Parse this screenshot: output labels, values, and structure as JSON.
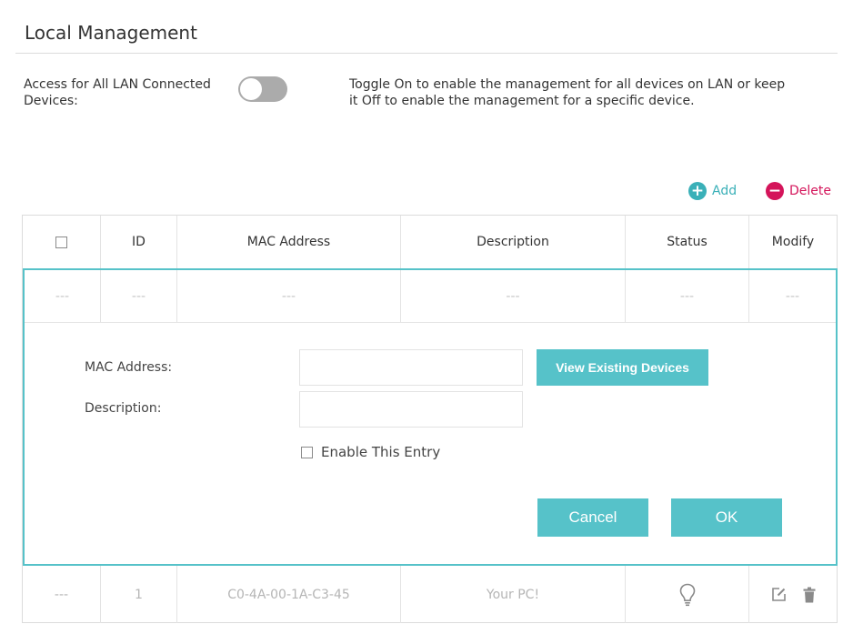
{
  "page": {
    "title": "Local Management",
    "access_label": "Access for All LAN Connected Devices:",
    "toggle_state": "off",
    "hint": "Toggle On to enable the management for all devices on LAN or keep it Off to enable the management for a specific device."
  },
  "toolbar": {
    "add_label": "Add",
    "delete_label": "Delete"
  },
  "table": {
    "headers": {
      "id": "ID",
      "mac": "MAC Address",
      "description": "Description",
      "status": "Status",
      "modify": "Modify"
    },
    "placeholder_row": {
      "select": "---",
      "id": "---",
      "mac": "---",
      "description": "---",
      "status": "---",
      "modify": "---"
    },
    "rows": [
      {
        "select": "---",
        "id": "1",
        "mac": "C0-4A-00-1A-C3-45",
        "description": "Your PC!",
        "status_icon": "bulb-icon",
        "modify_icons": [
          "edit-icon",
          "trash-icon"
        ]
      }
    ]
  },
  "form": {
    "mac_label": "MAC Address:",
    "mac_value": "",
    "description_label": "Description:",
    "description_value": "",
    "view_devices_label": "View Existing Devices",
    "enable_label": "Enable This Entry",
    "enable_checked": false,
    "cancel_label": "Cancel",
    "ok_label": "OK"
  },
  "colors": {
    "accent": "#56c2c9",
    "delete": "#d4145a",
    "toggle_off": "#ababab"
  }
}
